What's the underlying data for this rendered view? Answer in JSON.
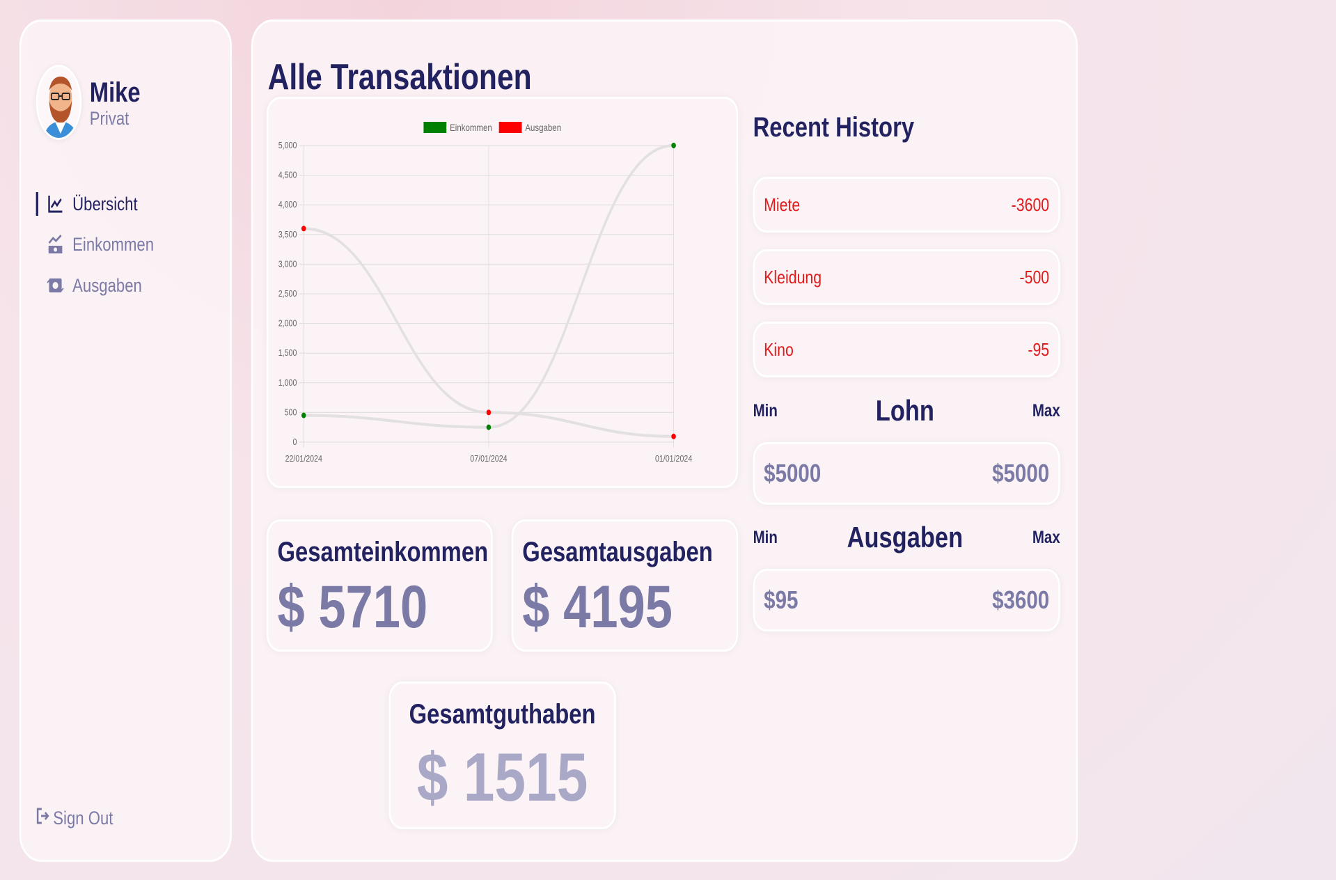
{
  "user": {
    "name": "Mike",
    "role": "Privat"
  },
  "nav": {
    "items": [
      {
        "label": "Übersicht",
        "icon": "chart-line-icon",
        "active": true
      },
      {
        "label": "Einkommen",
        "icon": "money-trend-icon",
        "active": false
      },
      {
        "label": "Ausgaben",
        "icon": "money-exchange-icon",
        "active": false
      }
    ],
    "signout_label": "Sign Out"
  },
  "page": {
    "title": "Alle Transaktionen"
  },
  "chart_data": {
    "type": "line",
    "categories": [
      "22/01/2024",
      "07/01/2024",
      "01/01/2024"
    ],
    "series": [
      {
        "name": "Einkommen",
        "color": "#008000",
        "values": [
          450,
          250,
          5000
        ]
      },
      {
        "name": "Ausgaben",
        "color": "#ff0000",
        "values": [
          3600,
          500,
          95
        ]
      }
    ],
    "ylim": [
      0,
      5000
    ],
    "yticks": [
      "0",
      "500",
      "1,000",
      "1,500",
      "2,000",
      "2,500",
      "3,000",
      "3,500",
      "4,000",
      "4,500",
      "5,000"
    ],
    "legend": "top-center",
    "grid": true
  },
  "stats": {
    "income": {
      "title": "Gesamteinkommen",
      "value": "$ 5710"
    },
    "expenses": {
      "title": "Gesamtausgaben",
      "value": "$ 4195"
    },
    "balance": {
      "title": "Gesamtguthaben",
      "value": "$ 1515"
    }
  },
  "history": {
    "title": "Recent History",
    "items": [
      {
        "label": "Miete",
        "amount": "-3600"
      },
      {
        "label": "Kleidung",
        "amount": "-500"
      },
      {
        "label": "Kino",
        "amount": "-95"
      }
    ]
  },
  "salary": {
    "title": "Lohn",
    "min_label": "Min",
    "max_label": "Max",
    "min": "$5000",
    "max": "$5000"
  },
  "expense_range": {
    "title": "Ausgaben",
    "min_label": "Min",
    "max_label": "Max",
    "min": "$95",
    "max": "$3600"
  }
}
